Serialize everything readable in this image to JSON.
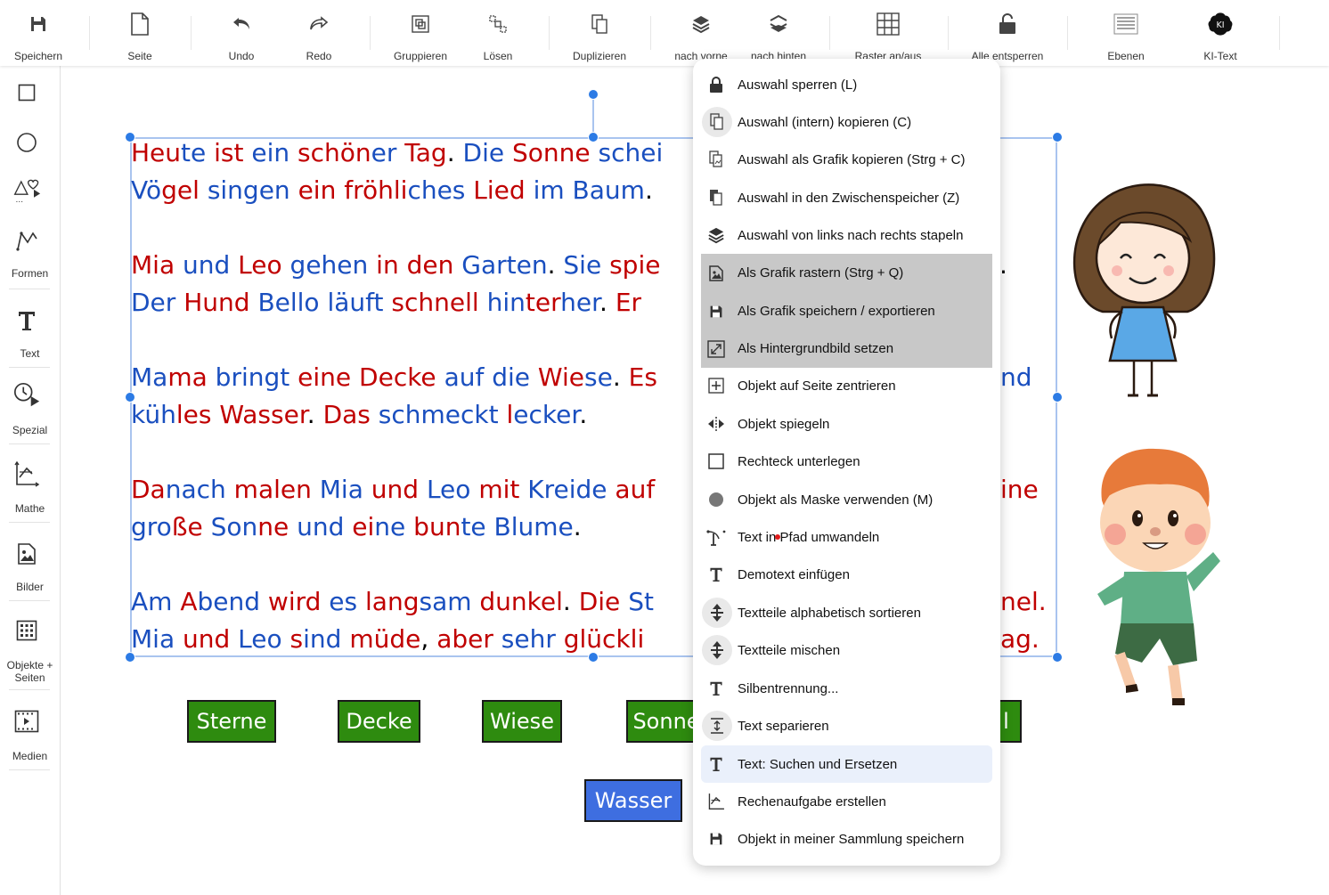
{
  "toolbar": {
    "items": [
      {
        "label": "Speichern",
        "icon": "floppy-icon"
      },
      {
        "label": "Seite",
        "icon": "page-icon"
      },
      {
        "label": "Undo",
        "icon": "undo-icon"
      },
      {
        "label": "Redo",
        "icon": "redo-icon"
      },
      {
        "label": "Gruppieren",
        "icon": "group-icon"
      },
      {
        "label": "Lösen",
        "icon": "ungroup-icon"
      },
      {
        "label": "Duplizieren",
        "icon": "duplicate-icon"
      },
      {
        "label": "nach vorne",
        "icon": "bring-forward-icon"
      },
      {
        "label": "nach hinten",
        "icon": "send-backward-icon"
      },
      {
        "label": "Raster an/aus",
        "icon": "grid-icon"
      },
      {
        "label": "Alle entsperren",
        "icon": "unlock-icon"
      },
      {
        "label": "Ebenen",
        "icon": "layers-icon"
      },
      {
        "label": "KI-Text",
        "icon": "ai-brain-icon",
        "icon_text": "KI"
      }
    ]
  },
  "sidebar": {
    "items": [
      {
        "label": "",
        "icon": "rectangle-icon"
      },
      {
        "label": "",
        "icon": "circle-icon"
      },
      {
        "label": "",
        "icon": "shapes-icon",
        "icon_text": "..."
      },
      {
        "label": "Formen",
        "icon": "polyline-icon"
      },
      {
        "label": "Text",
        "icon": "text-icon"
      },
      {
        "label": "Spezial",
        "icon": "clock-icon"
      },
      {
        "label": "Mathe",
        "icon": "math-icon"
      },
      {
        "label": "Bilder",
        "icon": "image-icon"
      },
      {
        "label": "Objekte +\nSeiten",
        "icon": "grid-dots-icon"
      },
      {
        "label": "Medien",
        "icon": "film-icon"
      }
    ]
  },
  "text_lines": [
    [
      [
        "Heu",
        "r"
      ],
      [
        "te ",
        "b"
      ],
      [
        "ist ",
        "r"
      ],
      [
        "ein ",
        "b"
      ],
      [
        "schön",
        "r"
      ],
      [
        "er ",
        "b"
      ],
      [
        "Tag",
        "r"
      ],
      [
        ". ",
        "k"
      ],
      [
        "Die ",
        "b"
      ],
      [
        "Sonne ",
        "r"
      ],
      [
        "schei",
        "b"
      ]
    ],
    [
      [
        "Vö",
        "b"
      ],
      [
        "gel ",
        "r"
      ],
      [
        "singen ",
        "b"
      ],
      [
        "ein ",
        "r"
      ],
      [
        "fröhli",
        "r"
      ],
      [
        "ches ",
        "b"
      ],
      [
        "Lied ",
        "r"
      ],
      [
        "im ",
        "b"
      ],
      [
        "Baum",
        "b"
      ],
      [
        ".",
        "k"
      ]
    ],
    [
      [
        "Mia ",
        "r"
      ],
      [
        "und ",
        "b"
      ],
      [
        "Leo ",
        "r"
      ],
      [
        "gehen ",
        "b"
      ],
      [
        "in ",
        "r"
      ],
      [
        "den ",
        "r"
      ],
      [
        "Garten",
        "b"
      ],
      [
        ". ",
        "k"
      ],
      [
        "Sie ",
        "b"
      ],
      [
        "spie",
        "r"
      ]
    ],
    [
      [
        "Der ",
        "b"
      ],
      [
        "Hund ",
        "r"
      ],
      [
        "Bello ",
        "b"
      ],
      [
        "läuft ",
        "b"
      ],
      [
        "schnell ",
        "r"
      ],
      [
        "hin",
        "b"
      ],
      [
        "ter",
        "r"
      ],
      [
        "her",
        "b"
      ],
      [
        ". ",
        "k"
      ],
      [
        "Er",
        "r"
      ]
    ],
    [
      [
        "Ma",
        "b"
      ],
      [
        "ma ",
        "r"
      ],
      [
        "bringt ",
        "b"
      ],
      [
        "eine ",
        "r"
      ],
      [
        "Decke ",
        "r"
      ],
      [
        "auf ",
        "b"
      ],
      [
        "die ",
        "b"
      ],
      [
        "Wie",
        "r"
      ],
      [
        "se",
        "b"
      ],
      [
        ". ",
        "k"
      ],
      [
        "Es",
        "r"
      ]
    ],
    [
      [
        "küh",
        "b"
      ],
      [
        "les ",
        "r"
      ],
      [
        "Wasser",
        "r"
      ],
      [
        ". ",
        "k"
      ],
      [
        "Das ",
        "r"
      ],
      [
        "schmeckt ",
        "b"
      ],
      [
        "l",
        "r"
      ],
      [
        "ecker",
        "b"
      ],
      [
        ".",
        "k"
      ]
    ],
    [
      [
        "Da",
        "r"
      ],
      [
        "nach ",
        "b"
      ],
      [
        "malen ",
        "r"
      ],
      [
        "Mia ",
        "b"
      ],
      [
        "und ",
        "r"
      ],
      [
        "Leo ",
        "b"
      ],
      [
        "mit ",
        "r"
      ],
      [
        "Kreide ",
        "b"
      ],
      [
        "auf",
        "r"
      ]
    ],
    [
      [
        "gro",
        "b"
      ],
      [
        "ße ",
        "r"
      ],
      [
        "Son",
        "b"
      ],
      [
        "ne ",
        "r"
      ],
      [
        "und ",
        "b"
      ],
      [
        "ei",
        "r"
      ],
      [
        "ne ",
        "b"
      ],
      [
        "bun",
        "r"
      ],
      [
        "te ",
        "b"
      ],
      [
        "Blume",
        "b"
      ],
      [
        ".",
        "k"
      ]
    ],
    [
      [
        "Am ",
        "b"
      ],
      [
        "A",
        "r"
      ],
      [
        "bend ",
        "b"
      ],
      [
        "wird ",
        "r"
      ],
      [
        "es ",
        "b"
      ],
      [
        "lang",
        "r"
      ],
      [
        "sam ",
        "b"
      ],
      [
        "dunkel",
        "r"
      ],
      [
        ". ",
        "k"
      ],
      [
        "Die ",
        "r"
      ],
      [
        "St",
        "b"
      ]
    ],
    [
      [
        "Mia ",
        "b"
      ],
      [
        "und ",
        "r"
      ],
      [
        "Leo ",
        "b"
      ],
      [
        "s",
        "r"
      ],
      [
        "ind ",
        "b"
      ],
      [
        "müde",
        "r"
      ],
      [
        ", ",
        "k"
      ],
      [
        "aber ",
        "r"
      ],
      [
        "sehr ",
        "b"
      ],
      [
        "glückli",
        "r"
      ]
    ]
  ],
  "text_tails": [
    {
      "text": ".",
      "color": "k"
    },
    {
      "text": "nd",
      "color": "b"
    },
    {
      "text": "ine",
      "color": "r"
    },
    {
      "text": "nel.",
      "color": "r"
    },
    {
      "text": "ag.",
      "color": "r"
    }
  ],
  "word_buttons": [
    {
      "label": "Sterne",
      "color": "green"
    },
    {
      "label": "Decke",
      "color": "green"
    },
    {
      "label": "Wiese",
      "color": "green"
    },
    {
      "label": "Sonne",
      "color": "green"
    },
    {
      "label": "l",
      "color": "green"
    },
    {
      "label": "Wasser",
      "color": "blue"
    }
  ],
  "context_menu": {
    "items": [
      {
        "label": "Auswahl sperren (L)",
        "icon": "lock-icon",
        "state": ""
      },
      {
        "label": "Auswahl (intern) kopieren (C)",
        "icon": "copy-icon",
        "state": "circle"
      },
      {
        "label": "Auswahl als Grafik kopieren (Strg + C)",
        "icon": "copy-graphic-icon",
        "state": ""
      },
      {
        "label": "Auswahl in den Zwischenspeicher (Z)",
        "icon": "clipboard-icon",
        "state": ""
      },
      {
        "label": "Auswahl von links nach rechts stapeln",
        "icon": "stack-icon",
        "state": ""
      },
      {
        "label": "Als Grafik rastern (Strg + Q)",
        "icon": "raster-image-icon",
        "state": "grey"
      },
      {
        "label": "Als Grafik speichern / exportieren",
        "icon": "save-icon",
        "state": "grey"
      },
      {
        "label": "Als Hintergrundbild setzen",
        "icon": "background-icon",
        "state": "grey"
      },
      {
        "label": "Objekt auf Seite zentrieren",
        "icon": "center-icon",
        "state": ""
      },
      {
        "label": "Objekt spiegeln",
        "icon": "mirror-icon",
        "state": ""
      },
      {
        "label": "Rechteck unterlegen",
        "icon": "rect-outline-icon",
        "state": ""
      },
      {
        "label": "Objekt als Maske verwenden (M)",
        "icon": "mask-icon",
        "state": ""
      },
      {
        "label": "Text in Pfad umwandeln",
        "icon": "path-icon",
        "state": ""
      },
      {
        "label": "Demotext einfügen",
        "icon": "text-t-icon",
        "state": ""
      },
      {
        "label": "Textteile alphabetisch sortieren",
        "icon": "sort-icon",
        "state": "circle"
      },
      {
        "label": "Textteile mischen",
        "icon": "shuffle-icon",
        "state": "circle"
      },
      {
        "label": "Silbentrennung...",
        "icon": "text-t-icon",
        "state": ""
      },
      {
        "label": "Text separieren",
        "icon": "separate-icon",
        "state": "circle"
      },
      {
        "label": "Text: Suchen und Ersetzen",
        "icon": "text-t-icon",
        "state": "hover"
      },
      {
        "label": "Rechenaufgabe erstellen",
        "icon": "math-task-icon",
        "state": ""
      },
      {
        "label": "Objekt in meiner Sammlung speichern",
        "icon": "save-icon",
        "state": ""
      }
    ]
  },
  "colors": {
    "accent": "#2c7be5",
    "word_green": "#2e8b0f",
    "word_blue": "#3e6ee0",
    "text_red": "#c00000",
    "text_blue": "#1a4fbf"
  }
}
